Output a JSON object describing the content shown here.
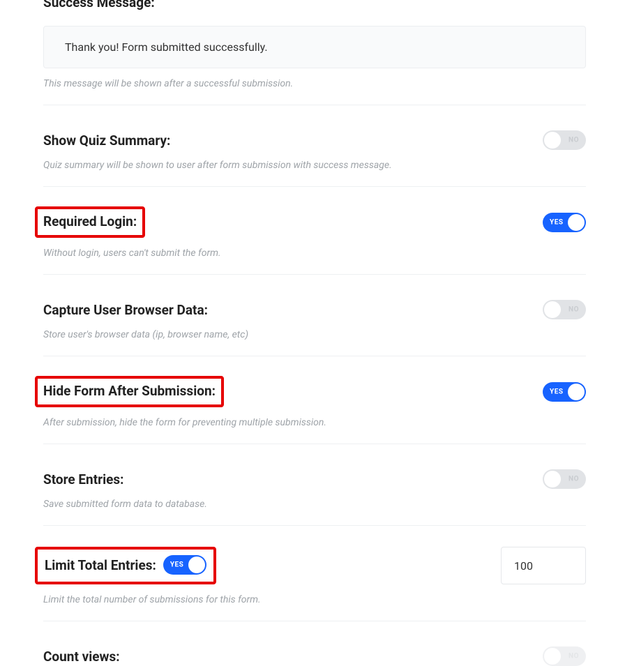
{
  "section_title": "Success Message:",
  "success_message": "Thank you! Form submitted successfully.",
  "success_hint": "This message will be shown after a successful submission.",
  "toggle_on_label": "YES",
  "toggle_off_label": "NO",
  "settings": {
    "quiz_summary": {
      "label": "Show Quiz Summary:",
      "desc": "Quiz summary will be shown to user after form submission with success message."
    },
    "required_login": {
      "label": "Required Login:",
      "desc": "Without login, users can't submit the form."
    },
    "capture_browser": {
      "label": "Capture User Browser Data:",
      "desc": "Store user's browser data (ip, browser name, etc)"
    },
    "hide_form": {
      "label": "Hide Form After Submission:",
      "desc": "After submission, hide the form for preventing multiple submission."
    },
    "store_entries": {
      "label": "Store Entries:",
      "desc": "Save submitted form data to database."
    },
    "limit_entries": {
      "label": "Limit Total Entries:",
      "desc": "Limit the total number of submissions for this form.",
      "value": "100"
    },
    "count_views": {
      "label": "Count views:"
    }
  }
}
